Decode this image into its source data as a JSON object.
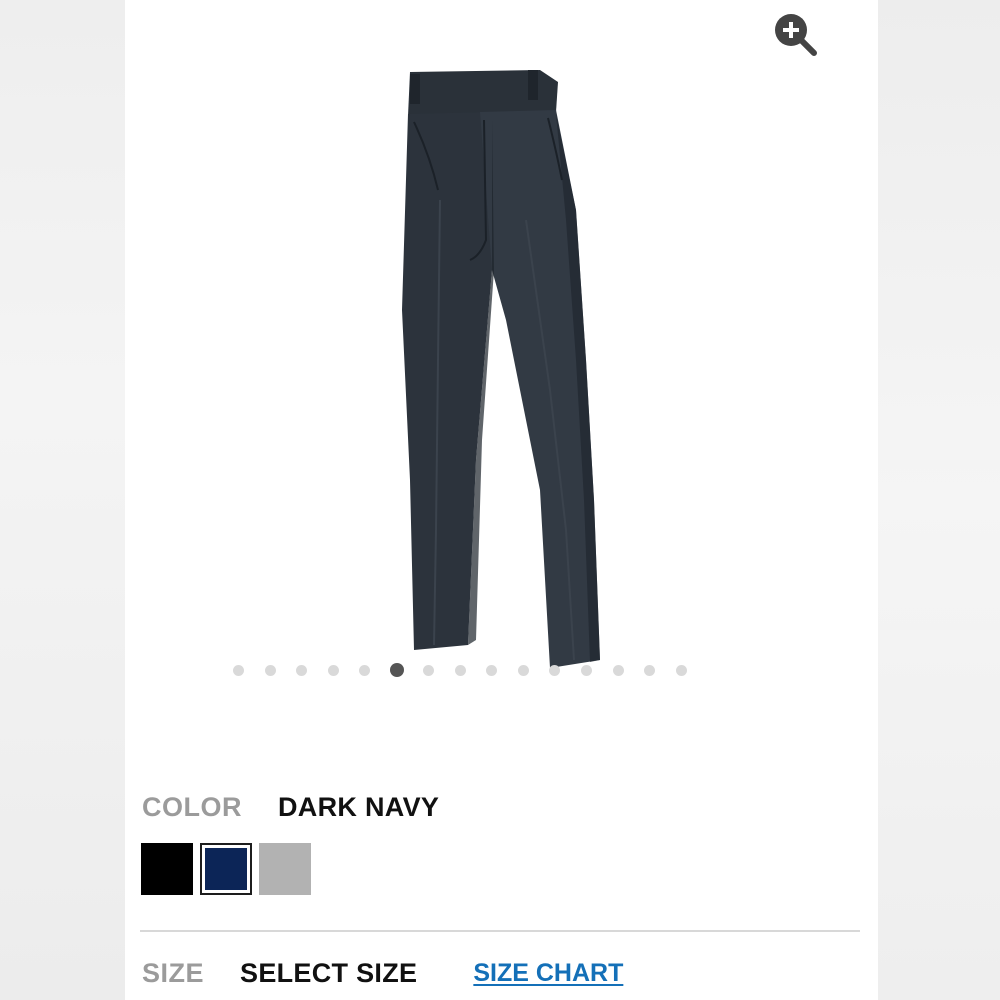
{
  "product": {
    "image_alt": "Dark navy work trousers",
    "colors": {
      "pants_main": "#2c333c",
      "pants_shadow": "#1d232b",
      "pants_highlight": "#3b434d"
    }
  },
  "gallery": {
    "zoom_icon": "zoom-in-icon",
    "total_slides": 15,
    "active_index": 5
  },
  "color_selector": {
    "label": "COLOR",
    "selected_value": "DARK NAVY",
    "swatches": [
      {
        "name": "Black",
        "hex": "#000000",
        "selected": false
      },
      {
        "name": "Dark Navy",
        "hex": "#0c2557",
        "selected": true
      },
      {
        "name": "Gray",
        "hex": "#b2b2b2",
        "selected": false
      }
    ]
  },
  "size_selector": {
    "label": "SIZE",
    "value": "SELECT SIZE",
    "chart_link": "SIZE CHART"
  },
  "theme": {
    "link_color": "#1470b8",
    "muted_label_color": "#9b9b9b"
  }
}
